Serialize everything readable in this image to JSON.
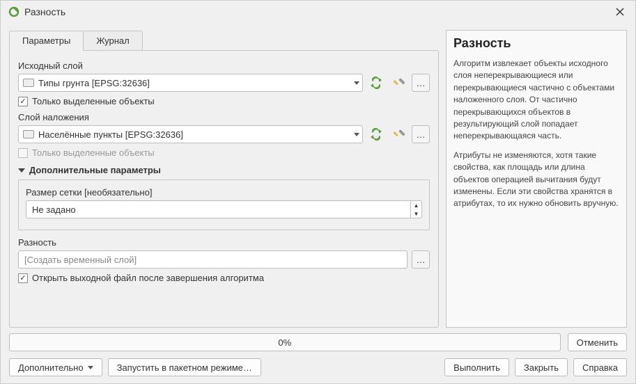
{
  "title": "Разность",
  "tabs": {
    "parameters": "Параметры",
    "log": "Журнал"
  },
  "labels": {
    "input_layer": "Исходный слой",
    "overlay_layer": "Слой наложения",
    "selected_only": "Только выделенные объекты",
    "advanced": "Дополнительные параметры",
    "grid_size": "Размер сетки [необязательно]",
    "grid_size_value": "Не задано",
    "output": "Разность",
    "output_placeholder": "[Создать временный слой]",
    "open_after": "Открыть выходной файл после завершения алгоритма"
  },
  "layers": {
    "input": "Типы грунта [EPSG:32636]",
    "overlay": "Населённые пункты [EPSG:32636]"
  },
  "progress_text": "0%",
  "buttons": {
    "cancel": "Отменить",
    "advanced": "Дополнительно",
    "batch": "Запустить в пакетном режиме…",
    "run": "Выполнить",
    "close": "Закрыть",
    "help": "Справка",
    "dots": "…"
  },
  "help": {
    "title": "Разность",
    "p1": "Алгоритм извлекает объекты исходного слоя неперекрывающиеся или перекрывающиеся частично с объектами наложенного слоя. От частично перекрывающихся объектов в результирующий слой попадает неперекрывающаяся часть.",
    "p2": "Атрибуты не изменяются, хотя такие свойства, как площадь или длина объектов операцией вычитания будут изменены. Если эти свойства хранятся в атрибутах, то их нужно обновить вручную."
  }
}
